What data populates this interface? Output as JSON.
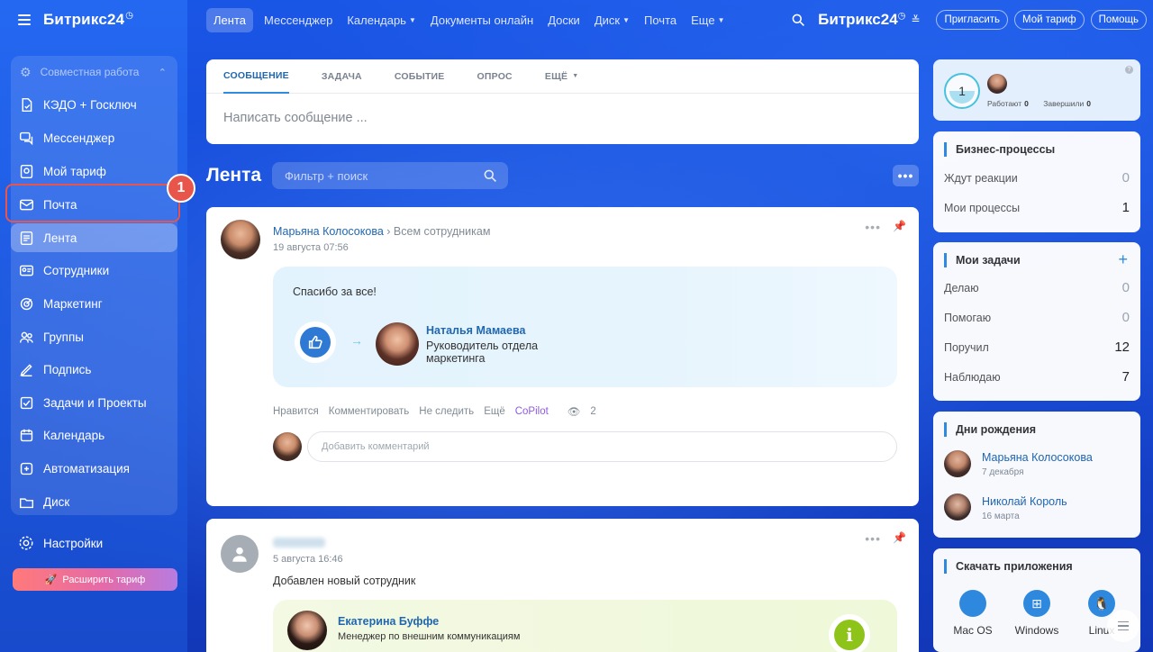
{
  "app": {
    "logo": "Битрикс24",
    "logo_mark": "◷"
  },
  "sidebar": {
    "section_title": "Совместная работа",
    "items": [
      {
        "label": "КЭДО + Госключ",
        "icon": "document-sign-icon"
      },
      {
        "label": "Мессенджер",
        "icon": "chat-icon"
      },
      {
        "label": "Мой тариф",
        "icon": "tariff-icon"
      },
      {
        "label": "Почта",
        "icon": "mail-icon"
      },
      {
        "label": "Лента",
        "icon": "feed-icon"
      },
      {
        "label": "Сотрудники",
        "icon": "employees-icon"
      },
      {
        "label": "Маркетинг",
        "icon": "marketing-icon"
      },
      {
        "label": "Группы",
        "icon": "groups-icon"
      },
      {
        "label": "Подпись",
        "icon": "signature-icon"
      },
      {
        "label": "Задачи и Проекты",
        "icon": "tasks-icon"
      },
      {
        "label": "Календарь",
        "icon": "calendar-icon"
      },
      {
        "label": "Автоматизация",
        "icon": "automation-icon"
      },
      {
        "label": "Диск",
        "icon": "disk-icon"
      }
    ],
    "settings_label": "Настройки",
    "upgrade_label": "Расширить тариф",
    "callout_number": "1"
  },
  "topnav": {
    "tabs": [
      {
        "label": "Лента"
      },
      {
        "label": "Мессенджер"
      },
      {
        "label": "Календарь"
      },
      {
        "label": "Документы онлайн"
      },
      {
        "label": "Доски"
      },
      {
        "label": "Диск"
      },
      {
        "label": "Почта"
      },
      {
        "label": "Еще"
      }
    ],
    "brand": "Битрикс24",
    "invite": "Пригласить",
    "tariff": "Мой тариф",
    "help": "Помощь"
  },
  "composer": {
    "tabs": [
      "СООБЩЕНИЕ",
      "ЗАДАЧА",
      "СОБЫТИЕ",
      "ОПРОС",
      "ЕЩЁ"
    ],
    "placeholder": "Написать сообщение ..."
  },
  "feed": {
    "title": "Лента",
    "filter_placeholder": "Фильтр + поиск",
    "more": "•••"
  },
  "post1": {
    "author": "Марьяна Колосокова",
    "target": "Всем сотрудникам",
    "date": "19 августа 07:56",
    "message": "Спасибо за все!",
    "recipient_name": "Наталья Мамаева",
    "recipient_role": "Руководитель отдела маркетинга",
    "actions": [
      "Нравится",
      "Комментировать",
      "Не следить",
      "Ещё"
    ],
    "copilot": "CoPilot",
    "views": "2",
    "comment_placeholder": "Добавить комментарий"
  },
  "post2": {
    "date": "5 августа 16:46",
    "text": "Добавлен новый сотрудник",
    "employee_name": "Екатерина Буффе",
    "employee_role": "Менеджер по внешним коммуникациям"
  },
  "timer": {
    "value": "1",
    "working_label": "Работают",
    "working": "0",
    "done_label": "Завершили",
    "done": "0"
  },
  "bp": {
    "title": "Бизнес-процессы",
    "rows": [
      {
        "label": "Ждут реакции",
        "value": "0"
      },
      {
        "label": "Мои процессы",
        "value": "1"
      }
    ]
  },
  "tasks": {
    "title": "Мои задачи",
    "rows": [
      {
        "label": "Делаю",
        "value": "0"
      },
      {
        "label": "Помогаю",
        "value": "0"
      },
      {
        "label": "Поручил",
        "value": "12"
      },
      {
        "label": "Наблюдаю",
        "value": "7"
      }
    ]
  },
  "birthdays": {
    "title": "Дни рождения",
    "people": [
      {
        "name": "Марьяна Колосокова",
        "date": "7 декабря"
      },
      {
        "name": "Николай Король",
        "date": "16 марта"
      }
    ]
  },
  "apps": {
    "title": "Скачать приложения",
    "items": [
      "Mac OS",
      "Windows",
      "Linux"
    ]
  }
}
